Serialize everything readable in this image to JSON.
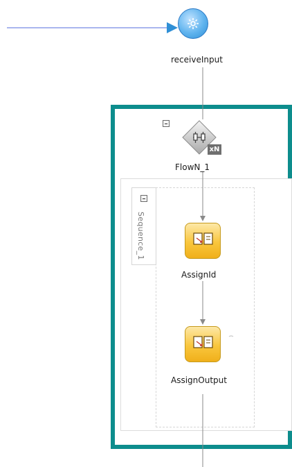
{
  "receive": {
    "label": "receiveInput",
    "icon": "gear-icon"
  },
  "flow": {
    "label": "FlowN_1",
    "badge": "xN",
    "icon": "flown-parallel-icon"
  },
  "sequence": {
    "label": "Sequence_1"
  },
  "assign_id": {
    "label": "AssignId",
    "icon": "assign-icon"
  },
  "assign_output": {
    "label": "AssignOutput",
    "icon": "assign-icon"
  },
  "colors": {
    "flow_border": "#0d8d8d",
    "receive_fill": "#5fb3ee",
    "assign_fill": "#f9c63d",
    "incoming_link": "#a9b6ee",
    "connector": "#8a8a8a"
  }
}
